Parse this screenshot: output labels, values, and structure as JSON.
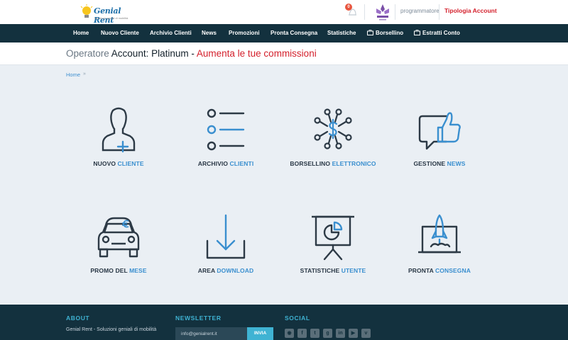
{
  "header": {
    "logo_brand": "Genial Rent",
    "logo_tagline": "soluzioni geniali di mobilità",
    "notifications_count": "0",
    "user_link": "programmatore",
    "account_link": "Tipologia Account"
  },
  "nav": {
    "items": [
      "Home",
      "Nuovo Cliente",
      "Archivio Clienti",
      "News",
      "Promozioni",
      "Pronta Consegna",
      "Statistiche",
      "Borsellino",
      "Estratti Conto"
    ]
  },
  "operator": {
    "label": "Operatore ",
    "account": "Account: Platinum",
    "dash": " - ",
    "promo": "Aumenta le tue commissioni"
  },
  "breadcrumb": {
    "home": "Home",
    "separator": "»"
  },
  "tiles": [
    {
      "word1": "NUOVO",
      "word2": "CLIENTE",
      "icon": "add-user-icon"
    },
    {
      "word1": "ARCHIVIO",
      "word2": "CLIENTI",
      "icon": "list-icon"
    },
    {
      "word1": "BORSELLINO",
      "word2": "ELETTRONICO",
      "icon": "wallet-network-icon"
    },
    {
      "word1": "GESTIONE",
      "word2": "NEWS",
      "icon": "thumbs-up-chat-icon"
    },
    {
      "word1": "PROMO DEL",
      "word2": "MESE",
      "icon": "car-icon"
    },
    {
      "word1": "AREA",
      "word2": "DOWNLOAD",
      "icon": "download-icon"
    },
    {
      "word1": "STATISTICHE",
      "word2": "UTENTE",
      "icon": "presentation-chart-icon"
    },
    {
      "word1": "PRONTA",
      "word2": "CONSEGNA",
      "icon": "rocket-monitor-icon"
    }
  ],
  "footer": {
    "about_title": "ABOUT",
    "about_text": "Genial Rent - Soluzioni geniali di mobilità",
    "newsletter_title": "NEWSLETTER",
    "newsletter_value": "info@genialrent.it",
    "newsletter_button": "INVIA",
    "social_title": "SOCIAL",
    "social_icons": [
      "rss-icon",
      "facebook-icon",
      "twitter-icon",
      "google-plus-icon",
      "linkedin-icon",
      "youtube-icon",
      "vimeo-icon"
    ]
  },
  "colors": {
    "nav_bg": "#13313e",
    "accent_blue": "#3a8fcf",
    "accent_red": "#d4202c",
    "footer_accent": "#3fb3d3",
    "page_bg": "#eaeff4"
  }
}
